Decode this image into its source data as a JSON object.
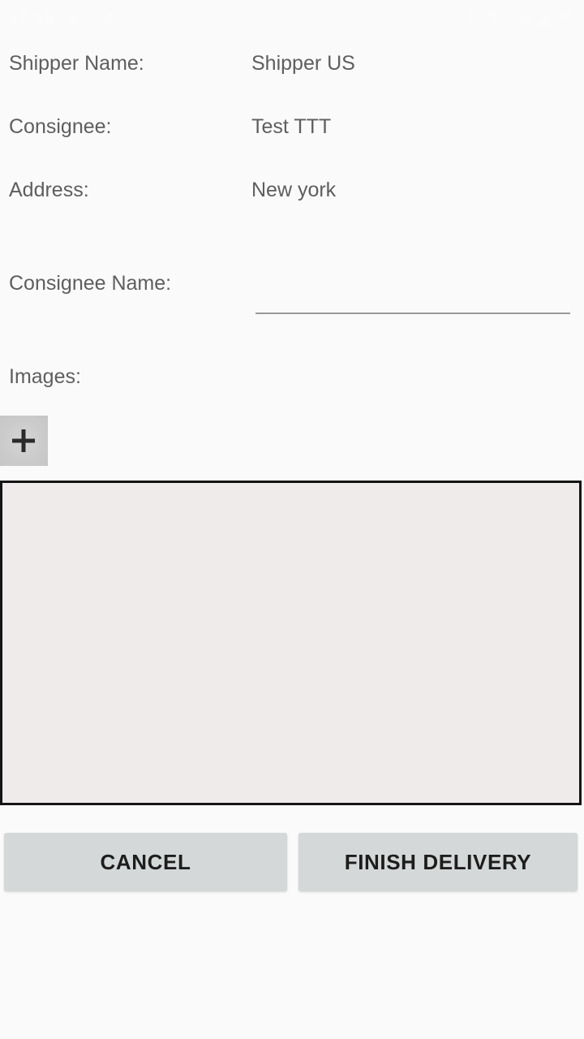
{
  "status_bar": {
    "time": "12:19",
    "battery_percent": "46",
    "left_icons": [
      "notification-icon",
      "screenshot-icon"
    ],
    "right_icons": [
      "volume-mute-icon",
      "bluetooth-icon",
      "wifi-icon",
      "cellular-signal-icon",
      "battery-icon"
    ]
  },
  "form": {
    "rows": [
      {
        "label": "Shipper Name:",
        "value": "Shipper US"
      },
      {
        "label": "Consignee:",
        "value": "Test TTT"
      },
      {
        "label": "Address:",
        "value": "New york"
      }
    ],
    "consignee_name": {
      "label": "Consignee Name:",
      "value": "",
      "placeholder": ""
    },
    "images": {
      "label": "Images:",
      "add_button_icon": "plus-icon"
    },
    "signature": {
      "name": "signature-pad"
    }
  },
  "actions": {
    "cancel_label": "CANCEL",
    "finish_label": "FINISH DELIVERY"
  },
  "colors": {
    "page_background": "#fafafa",
    "text": "#5e5e5e",
    "button_background": "#d5d8d8",
    "button_text": "#1d1d1d",
    "signature_fill": "#f0ebeb",
    "signature_border": "#151515",
    "underline": "#9a9a9a"
  }
}
